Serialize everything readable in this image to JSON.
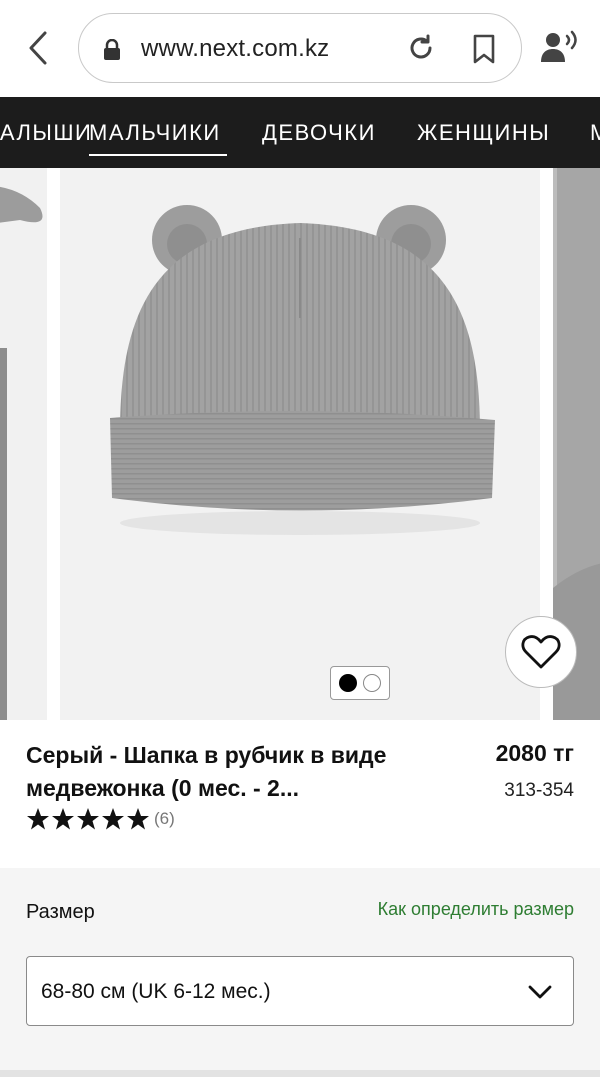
{
  "browser": {
    "url": "www.next.com.kz"
  },
  "nav": {
    "items": [
      {
        "label": "МАЛЫШИ",
        "active": false
      },
      {
        "label": "МАЛЬЧИКИ",
        "active": true
      },
      {
        "label": "ДЕВОЧКИ",
        "active": false
      },
      {
        "label": "ЖЕНЩИНЫ",
        "active": false
      },
      {
        "label": "МУЖЧИНЫ",
        "active": false
      }
    ]
  },
  "carousel": {
    "image_count": 2,
    "current_index": 0
  },
  "product": {
    "title": "Серый - Шапка в рубчик в виде медвежонка (0 мес. - 2...",
    "price": "2080 тг",
    "sku": "313-354",
    "rating": 5,
    "rating_count": "(6)"
  },
  "size": {
    "label": "Размер",
    "guide_link": "Как определить размер",
    "selected": "68-80 см (UK 6-12 мес.)"
  },
  "colors": {
    "nav_bg": "#1c1c1c",
    "link_green": "#2e7d32",
    "hat_grey": "#9a9a9a"
  }
}
